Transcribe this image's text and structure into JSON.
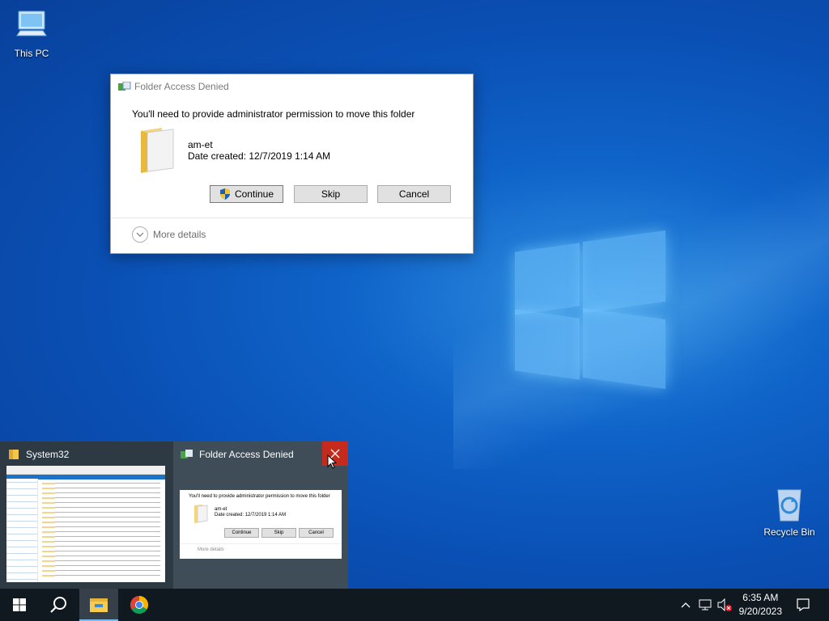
{
  "desktop": {
    "icons": [
      {
        "label": "This PC",
        "icon": "this-pc-icon"
      },
      {
        "label": "Recycle Bin",
        "icon": "recycle-bin-icon"
      }
    ]
  },
  "dialog": {
    "title": "Folder Access Denied",
    "message": "You'll need to provide administrator permission to move this folder",
    "item_name": "am-et",
    "item_date": "Date created: 12/7/2019 1:14 AM",
    "buttons": {
      "continue": "Continue",
      "skip": "Skip",
      "cancel": "Cancel"
    },
    "more_details": "More details"
  },
  "taskbar_preview": {
    "windows": [
      {
        "title": "System32"
      },
      {
        "title": "Folder Access Denied"
      }
    ],
    "preview_dialog": {
      "message": "You'll need to provide administrator permission to move this folder",
      "item_name": "am-et",
      "item_date": "Date created: 12/7/2019 1:14 AM",
      "buttons": {
        "continue": "Continue",
        "skip": "Skip",
        "cancel": "Cancel"
      },
      "more_details": "More details"
    }
  },
  "taskbar": {
    "pinned": [
      "start-icon",
      "search-icon",
      "file-explorer-icon",
      "chrome-icon"
    ],
    "clock": {
      "time": "6:35 AM",
      "date": "9/20/2023"
    }
  },
  "colors": {
    "close_hover": "#c42b1c",
    "accent": "#76b9ed",
    "taskbar": "#101820"
  }
}
